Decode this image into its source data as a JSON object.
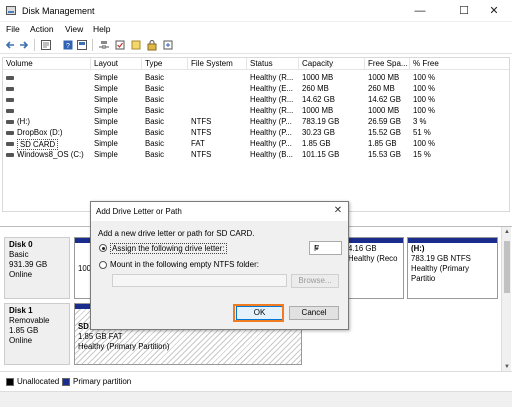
{
  "window": {
    "title": "Disk Management",
    "controls": {
      "minimize": "—",
      "maximize": "☐",
      "close": "✕"
    }
  },
  "menu": [
    "File",
    "Action",
    "View",
    "Help"
  ],
  "toolbar_icons": [
    "back-icon",
    "forward-icon",
    "properties-icon",
    "help-icon",
    "connect-icon",
    "check-icon",
    "new-icon",
    "lock-icon",
    "refresh-icon"
  ],
  "table": {
    "headers": [
      "Volume",
      "Layout",
      "Type",
      "File System",
      "Status",
      "Capacity",
      "Free Spa...",
      "% Free"
    ],
    "rows": [
      {
        "volume": "",
        "layout": "Simple",
        "type": "Basic",
        "fs": "",
        "status": "Healthy (R...",
        "capacity": "1000 MB",
        "free": "1000 MB",
        "pct": "100 %"
      },
      {
        "volume": "",
        "layout": "Simple",
        "type": "Basic",
        "fs": "",
        "status": "Healthy (E...",
        "capacity": "260 MB",
        "free": "260 MB",
        "pct": "100 %"
      },
      {
        "volume": "",
        "layout": "Simple",
        "type": "Basic",
        "fs": "",
        "status": "Healthy (R...",
        "capacity": "14.62 GB",
        "free": "14.62 GB",
        "pct": "100 %"
      },
      {
        "volume": "",
        "layout": "Simple",
        "type": "Basic",
        "fs": "",
        "status": "Healthy (R...",
        "capacity": "1000 MB",
        "free": "1000 MB",
        "pct": "100 %"
      },
      {
        "volume": "(H:)",
        "layout": "Simple",
        "type": "Basic",
        "fs": "NTFS",
        "status": "Healthy (P...",
        "capacity": "783.19 GB",
        "free": "26.59 GB",
        "pct": "3 %"
      },
      {
        "volume": "DropBox (D:)",
        "layout": "Simple",
        "type": "Basic",
        "fs": "NTFS",
        "status": "Healthy (P...",
        "capacity": "30.23 GB",
        "free": "15.52 GB",
        "pct": "51 %"
      },
      {
        "volume": "SD CARD",
        "layout": "Simple",
        "type": "Basic",
        "fs": "FAT",
        "status": "Healthy (P...",
        "capacity": "1.85 GB",
        "free": "1.85 GB",
        "pct": "100 %"
      },
      {
        "volume": "Windows8_OS (C:)",
        "layout": "Simple",
        "type": "Basic",
        "fs": "NTFS",
        "status": "Healthy (B...",
        "capacity": "101.15 GB",
        "free": "15.53 GB",
        "pct": "15 %"
      }
    ]
  },
  "disks": [
    {
      "name": "Disk 0",
      "kind": "Basic",
      "size": "931.39 GB",
      "state": "Online",
      "partitions": [
        {
          "line1": "100",
          "line2": "",
          "line3": ""
        },
        {
          "line1": "",
          "line2": "4.16 GB",
          "line3": "Healthy (Reco"
        },
        {
          "line1": "(H:)",
          "line2": "783.19 GB NTFS",
          "line3": "Healthy (Primary Partitio"
        }
      ]
    },
    {
      "name": "Disk 1",
      "kind": "Removable",
      "size": "1.85 GB",
      "state": "Online",
      "partitions": [
        {
          "line1": "SD",
          "line2": "1.85 GB FAT",
          "line3": "Healthy (Primary Partition)"
        }
      ]
    }
  ],
  "legend": {
    "unallocated": "Unallocated",
    "primary": "Primary partition"
  },
  "colors": {
    "primary_bar": "#1a2d8c",
    "highlight": "#f07b21"
  },
  "dialog": {
    "title": "Add Drive Letter or Path",
    "description": "Add a new drive letter or path for SD CARD.",
    "option_assign": "Assign the following drive letter:",
    "drive_letter": "F",
    "option_mount": "Mount in the following empty NTFS folder:",
    "path_value": "",
    "browse": "Browse...",
    "ok": "OK",
    "cancel": "Cancel"
  }
}
